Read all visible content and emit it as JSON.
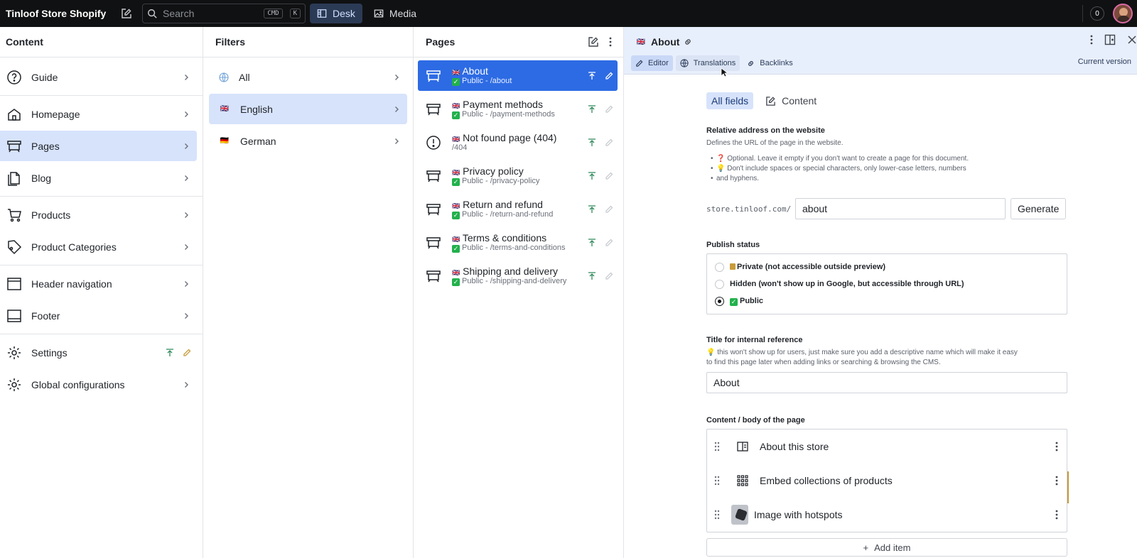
{
  "topbar": {
    "brand": "Tinloof Store Shopify",
    "search_placeholder": "Search",
    "kbd_cmd": "CMD",
    "kbd_k": "K",
    "nav": [
      {
        "label": "Desk",
        "icon": "desk-icon",
        "active": true
      },
      {
        "label": "Media",
        "icon": "image-icon",
        "active": false
      }
    ],
    "notifications": "0"
  },
  "content_pane": {
    "title": "Content",
    "items": [
      {
        "label": "Guide",
        "icon": "help-circle-icon"
      },
      {
        "label": "Homepage",
        "icon": "home-icon"
      },
      {
        "label": "Pages",
        "icon": "pages-icon",
        "selected": true
      },
      {
        "label": "Blog",
        "icon": "documents-icon"
      },
      {
        "label": "Products",
        "icon": "cart-icon"
      },
      {
        "label": "Product Categories",
        "icon": "tag-icon"
      },
      {
        "label": "Header navigation",
        "icon": "header-icon"
      },
      {
        "label": "Footer",
        "icon": "footer-icon"
      },
      {
        "label": "Settings",
        "icon": "gear-icon"
      },
      {
        "label": "Global configurations",
        "icon": "gear-icon"
      }
    ]
  },
  "filters_pane": {
    "title": "Filters",
    "items": [
      {
        "label": "All",
        "icon": "globe-icon"
      },
      {
        "label": "English",
        "flag": "🇬🇧",
        "selected": true
      },
      {
        "label": "German",
        "flag": "🇩🇪"
      }
    ]
  },
  "pages_pane": {
    "title": "Pages",
    "items": [
      {
        "title": "About",
        "flag": "🇬🇧",
        "status": "Public - /about",
        "selected": true
      },
      {
        "title": "Payment methods",
        "flag": "🇬🇧",
        "status": "Public - /payment-methods"
      },
      {
        "title": "Not found page (404)",
        "flag": "🇬🇧",
        "status": "/404",
        "warning": true
      },
      {
        "title": "Privacy policy",
        "flag": "🇬🇧",
        "status": "Public - /privacy-policy"
      },
      {
        "title": "Return and refund",
        "flag": "🇬🇧",
        "status": "Public - /return-and-refund"
      },
      {
        "title": "Terms & conditions",
        "flag": "🇬🇧",
        "status": "Public - /terms-and-conditions"
      },
      {
        "title": "Shipping and delivery",
        "flag": "🇬🇧",
        "status": "Public - /shipping-and-delivery"
      }
    ]
  },
  "document": {
    "flag": "🇬🇧",
    "title": "About",
    "tabs": [
      {
        "label": "Editor",
        "active": true
      },
      {
        "label": "Translations"
      },
      {
        "label": "Backlinks"
      }
    ],
    "current_version": "Current version",
    "field_tabs": [
      {
        "label": "All fields",
        "active": true
      },
      {
        "label": "Content"
      }
    ],
    "slug": {
      "label": "Relative address on the website",
      "description": "Defines the URL of the page in the website.",
      "bullet1": "❓ Optional. Leave it empty if you don't want to create a page for this document.",
      "bullet2_line1": "💡 Don't include spaces or special characters, only lower-case letters, numbers",
      "bullet2_line2": "and hyphens.",
      "prefix": "store.tinloof.com/",
      "value": "about",
      "generate": "Generate"
    },
    "publish": {
      "label": "Publish status",
      "options": [
        "Private (not accessible outside preview)",
        "Hidden (won't show up in Google, but accessible through URL)",
        "Public"
      ],
      "selected": 2
    },
    "internal_title": {
      "label": "Title for internal reference",
      "help1": "💡 this won't show up for users, just make sure you add a descriptive name which will make it easy",
      "help2": "to find this page later when adding links or searching & browsing the CMS.",
      "value": "About"
    },
    "body": {
      "label": "Content / body of the page",
      "items": [
        {
          "label": "About this store",
          "icon": "split-icon"
        },
        {
          "label": "Embed collections of products",
          "icon": "grid-icon"
        },
        {
          "label": "Image with hotspots",
          "icon": "image-thumb"
        }
      ],
      "add_item": "Add item"
    }
  }
}
